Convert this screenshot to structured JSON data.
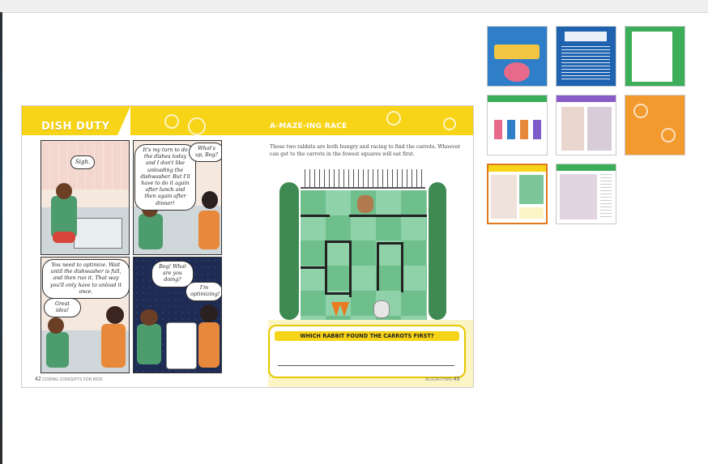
{
  "spread": {
    "left_title": "DISH DUTY",
    "right_title": "A-MAZE-ING RACE",
    "intro": "These two rabbits are both hungry and racing to find the carrots. Whoever can get to the carrots in the fewest squares will eat first.",
    "question": "WHICH RABBIT FOUND THE CARROTS FIRST?",
    "left_page_number": "42",
    "left_footer": "CODING CONCEPTS FOR KIDS",
    "right_page_number": "43",
    "right_footer": "ALGORITHMS"
  },
  "comic": {
    "p1_bubble": "Sigh.",
    "p2_bubble_a": "It's my turn to do the dishes today and I don't like unloading the dishwasher. But I'll have to do it again after lunch and then again after dinner!",
    "p2_bubble_b": "What's up, Bog?",
    "p3_bubble_a": "You need to optimize. Wait until the dishwasher is full, and then run it. That way you'll only have to unload it once.",
    "p3_bubble_b": "Great idea!",
    "p4_bubble_a": "Bog! What are you doing?",
    "p4_bubble_b": "I'm optimizing!"
  },
  "thumbnails": [
    {
      "label": "Coding Concepts cover"
    },
    {
      "label": "Coding without a computer"
    },
    {
      "label": "Contents"
    },
    {
      "label": "Characters page"
    },
    {
      "label": "Spread"
    },
    {
      "label": "Orange pattern"
    },
    {
      "label": "Dish Duty spread"
    },
    {
      "label": "Comic spread"
    }
  ],
  "colors": {
    "accent_yellow": "#f7d417",
    "selected_border": "#e07a1f",
    "maze_green": "#7cc79a",
    "hedge_green": "#3f8a52"
  }
}
